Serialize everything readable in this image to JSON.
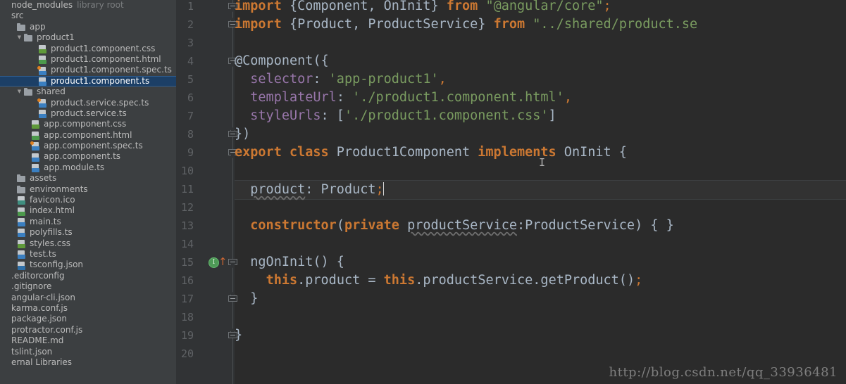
{
  "colors": {
    "editor_bg": "#2b2b2b",
    "sidebar_bg": "#3c3f41",
    "gutter_bg": "#313335",
    "selection_bg": "#1c3f66",
    "keyword": "#cc7832",
    "string": "#7a9c60",
    "field": "#9876aa",
    "plain": "#a9b7c6",
    "linenumber": "#606366",
    "impl_marker": "#4e9a57",
    "override_arrow": "#cc6633"
  },
  "sidebar": {
    "name": "project-tree",
    "items": [
      {
        "label": "node_modules",
        "suffix": "library root",
        "depth": 0,
        "icon": "none",
        "twisty": "",
        "selected": false
      },
      {
        "label": "src",
        "suffix": "",
        "depth": 0,
        "icon": "none",
        "twisty": "",
        "selected": false
      },
      {
        "label": "app",
        "suffix": "",
        "depth": 1,
        "icon": "folder",
        "twisty": "",
        "selected": false
      },
      {
        "label": "product1",
        "suffix": "",
        "depth": 2,
        "icon": "folder",
        "twisty": "▼",
        "selected": false
      },
      {
        "label": "product1.component.css",
        "suffix": "",
        "depth": 4,
        "icon": "css",
        "twisty": "",
        "selected": false
      },
      {
        "label": "product1.component.html",
        "suffix": "",
        "depth": 4,
        "icon": "html",
        "twisty": "",
        "selected": false
      },
      {
        "label": "product1.component.spec.ts",
        "suffix": "",
        "depth": 4,
        "icon": "spec-ts",
        "twisty": "",
        "selected": false
      },
      {
        "label": "product1.component.ts",
        "suffix": "",
        "depth": 4,
        "icon": "ts",
        "twisty": "",
        "selected": true
      },
      {
        "label": "shared",
        "suffix": "",
        "depth": 2,
        "icon": "folder",
        "twisty": "▼",
        "selected": false
      },
      {
        "label": "product.service.spec.ts",
        "suffix": "",
        "depth": 4,
        "icon": "spec-ts",
        "twisty": "",
        "selected": false
      },
      {
        "label": "product.service.ts",
        "suffix": "",
        "depth": 4,
        "icon": "ts",
        "twisty": "",
        "selected": false
      },
      {
        "label": "app.component.css",
        "suffix": "",
        "depth": 3,
        "icon": "css",
        "twisty": "",
        "selected": false
      },
      {
        "label": "app.component.html",
        "suffix": "",
        "depth": 3,
        "icon": "html",
        "twisty": "",
        "selected": false
      },
      {
        "label": "app.component.spec.ts",
        "suffix": "",
        "depth": 3,
        "icon": "spec-ts",
        "twisty": "",
        "selected": false
      },
      {
        "label": "app.component.ts",
        "suffix": "",
        "depth": 3,
        "icon": "ts",
        "twisty": "",
        "selected": false
      },
      {
        "label": "app.module.ts",
        "suffix": "",
        "depth": 3,
        "icon": "ts",
        "twisty": "",
        "selected": false
      },
      {
        "label": "assets",
        "suffix": "",
        "depth": 1,
        "icon": "folder",
        "twisty": "",
        "selected": false
      },
      {
        "label": "environments",
        "suffix": "",
        "depth": 1,
        "icon": "folder",
        "twisty": "",
        "selected": false
      },
      {
        "label": "favicon.ico",
        "suffix": "",
        "depth": 1,
        "icon": "ico",
        "twisty": "",
        "selected": false
      },
      {
        "label": "index.html",
        "suffix": "",
        "depth": 1,
        "icon": "html",
        "twisty": "",
        "selected": false
      },
      {
        "label": "main.ts",
        "suffix": "",
        "depth": 1,
        "icon": "ts",
        "twisty": "",
        "selected": false
      },
      {
        "label": "polyfills.ts",
        "suffix": "",
        "depth": 1,
        "icon": "ts",
        "twisty": "",
        "selected": false
      },
      {
        "label": "styles.css",
        "suffix": "",
        "depth": 1,
        "icon": "css",
        "twisty": "",
        "selected": false
      },
      {
        "label": "test.ts",
        "suffix": "",
        "depth": 1,
        "icon": "ts",
        "twisty": "",
        "selected": false
      },
      {
        "label": "tsconfig.json",
        "suffix": "",
        "depth": 1,
        "icon": "json",
        "twisty": "",
        "selected": false
      },
      {
        "label": ".editorconfig",
        "suffix": "",
        "depth": 0,
        "icon": "none",
        "twisty": "",
        "selected": false
      },
      {
        "label": ".gitignore",
        "suffix": "",
        "depth": 0,
        "icon": "none",
        "twisty": "",
        "selected": false
      },
      {
        "label": "angular-cli.json",
        "suffix": "",
        "depth": 0,
        "icon": "none",
        "twisty": "",
        "selected": false
      },
      {
        "label": "karma.conf.js",
        "suffix": "",
        "depth": 0,
        "icon": "none",
        "twisty": "",
        "selected": false
      },
      {
        "label": "package.json",
        "suffix": "",
        "depth": 0,
        "icon": "none",
        "twisty": "",
        "selected": false
      },
      {
        "label": "protractor.conf.js",
        "suffix": "",
        "depth": 0,
        "icon": "none",
        "twisty": "",
        "selected": false
      },
      {
        "label": "README.md",
        "suffix": "",
        "depth": 0,
        "icon": "none",
        "twisty": "",
        "selected": false
      },
      {
        "label": "tslint.json",
        "suffix": "",
        "depth": 0,
        "icon": "none",
        "twisty": "",
        "selected": false
      },
      {
        "label": "ernal Libraries",
        "suffix": "",
        "depth": 0,
        "icon": "none",
        "twisty": "",
        "selected": false
      }
    ]
  },
  "editor": {
    "line_numbers": [
      "1",
      "2",
      "3",
      "4",
      "5",
      "6",
      "7",
      "8",
      "9",
      "10",
      "11",
      "12",
      "13",
      "14",
      "15",
      "16",
      "17",
      "18",
      "19",
      "20"
    ],
    "current_line": 11,
    "lines": [
      {
        "n": 1,
        "tokens": [
          {
            "t": "import",
            "c": "kw"
          },
          {
            "t": " {Component, OnInit} ",
            "c": "pln"
          },
          {
            "t": "from",
            "c": "kw"
          },
          {
            "t": " ",
            "c": "pln"
          },
          {
            "t": "\"@angular/core\"",
            "c": "str"
          },
          {
            "t": ";",
            "c": "punc"
          }
        ]
      },
      {
        "n": 2,
        "tokens": [
          {
            "t": "import",
            "c": "kw"
          },
          {
            "t": " {Product, ProductService} ",
            "c": "pln"
          },
          {
            "t": "from",
            "c": "kw"
          },
          {
            "t": " ",
            "c": "pln"
          },
          {
            "t": "\"../shared/product.se",
            "c": "str"
          }
        ]
      },
      {
        "n": 3,
        "tokens": []
      },
      {
        "n": 4,
        "tokens": [
          {
            "t": "@Component({",
            "c": "pln"
          }
        ]
      },
      {
        "n": 5,
        "tokens": [
          {
            "t": "  ",
            "c": "pln"
          },
          {
            "t": "selector",
            "c": "fld"
          },
          {
            "t": ": ",
            "c": "pln"
          },
          {
            "t": "'app-product1'",
            "c": "str"
          },
          {
            "t": ",",
            "c": "punc"
          }
        ]
      },
      {
        "n": 6,
        "tokens": [
          {
            "t": "  ",
            "c": "pln"
          },
          {
            "t": "templateUrl",
            "c": "fld"
          },
          {
            "t": ": ",
            "c": "pln"
          },
          {
            "t": "'./product1.component.html'",
            "c": "str"
          },
          {
            "t": ",",
            "c": "punc"
          }
        ]
      },
      {
        "n": 7,
        "tokens": [
          {
            "t": "  ",
            "c": "pln"
          },
          {
            "t": "styleUrls",
            "c": "fld"
          },
          {
            "t": ": [",
            "c": "pln"
          },
          {
            "t": "'./product1.component.css'",
            "c": "str"
          },
          {
            "t": "]",
            "c": "pln"
          }
        ]
      },
      {
        "n": 8,
        "tokens": [
          {
            "t": "})",
            "c": "pln"
          }
        ]
      },
      {
        "n": 9,
        "tokens": [
          {
            "t": "export class",
            "c": "kw"
          },
          {
            "t": " Product1Component ",
            "c": "pln"
          },
          {
            "t": "implements",
            "c": "kw"
          },
          {
            "t": " OnInit {",
            "c": "pln"
          }
        ]
      },
      {
        "n": 10,
        "tokens": []
      },
      {
        "n": 11,
        "tokens": [
          {
            "t": "  ",
            "c": "pln"
          },
          {
            "t": "product",
            "c": "pln wavy"
          },
          {
            "t": ": Product",
            "c": "pln"
          },
          {
            "t": ";",
            "c": "punc"
          }
        ]
      },
      {
        "n": 12,
        "tokens": []
      },
      {
        "n": 13,
        "tokens": [
          {
            "t": "  ",
            "c": "pln"
          },
          {
            "t": "constructor",
            "c": "kw"
          },
          {
            "t": "(",
            "c": "pln"
          },
          {
            "t": "private",
            "c": "kw"
          },
          {
            "t": " ",
            "c": "pln"
          },
          {
            "t": "productService",
            "c": "pln wavy"
          },
          {
            "t": ":ProductService) { }",
            "c": "pln"
          }
        ]
      },
      {
        "n": 14,
        "tokens": []
      },
      {
        "n": 15,
        "tokens": [
          {
            "t": "  ngOnInit() {",
            "c": "pln"
          }
        ]
      },
      {
        "n": 16,
        "tokens": [
          {
            "t": "    ",
            "c": "pln"
          },
          {
            "t": "this",
            "c": "kw"
          },
          {
            "t": ".product = ",
            "c": "pln"
          },
          {
            "t": "this",
            "c": "kw"
          },
          {
            "t": ".productService.getProduct()",
            "c": "pln"
          },
          {
            "t": ";",
            "c": "punc"
          }
        ]
      },
      {
        "n": 17,
        "tokens": [
          {
            "t": "  }",
            "c": "pln"
          }
        ]
      },
      {
        "n": 18,
        "tokens": []
      },
      {
        "n": 19,
        "tokens": [
          {
            "t": "}",
            "c": "pln"
          }
        ]
      },
      {
        "n": 20,
        "tokens": []
      }
    ],
    "fold_markers": [
      {
        "line": 1,
        "kind": "top"
      },
      {
        "line": 2,
        "kind": "bot"
      },
      {
        "line": 4,
        "kind": "top"
      },
      {
        "line": 8,
        "kind": "bot"
      },
      {
        "line": 9,
        "kind": "top"
      },
      {
        "line": 15,
        "kind": "top"
      },
      {
        "line": 17,
        "kind": "bot"
      },
      {
        "line": 19,
        "kind": "bot"
      }
    ],
    "impl_marker": {
      "line": 15,
      "glyph": "I",
      "label": "implementing-method-marker"
    },
    "override_arrow": {
      "line": 15,
      "glyph": "↑",
      "label": "overriding-method-arrow"
    }
  },
  "watermark": {
    "text": "http://blog.csdn.net/qq_33936481"
  }
}
